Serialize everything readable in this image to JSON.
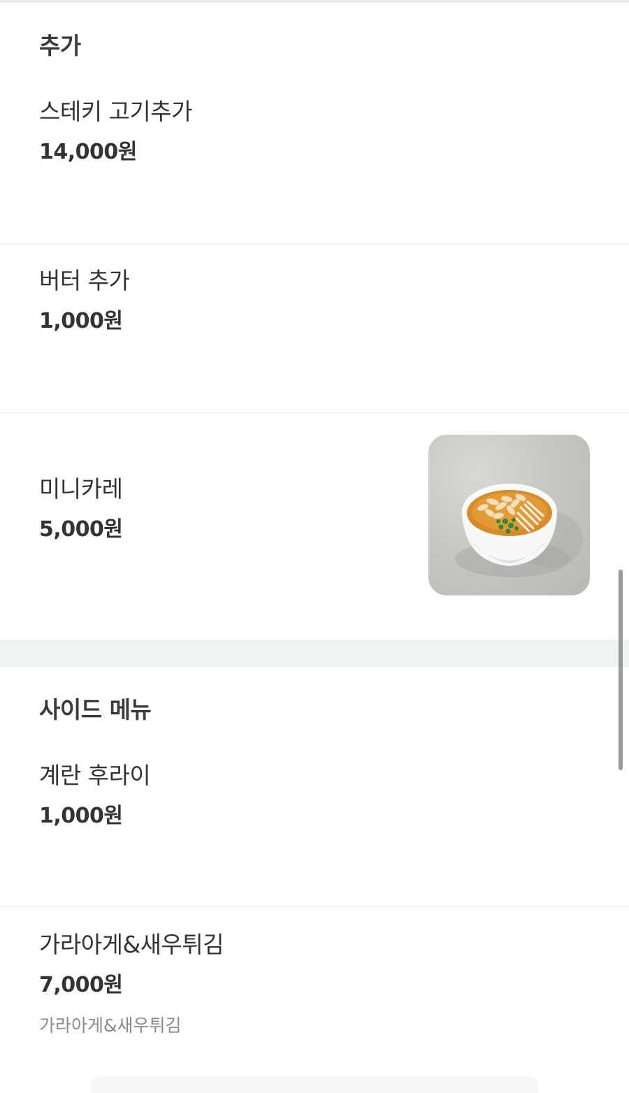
{
  "sections": {
    "add": {
      "title": "추가",
      "items": [
        {
          "name": "스테키 고기추가",
          "price": "14,000원"
        },
        {
          "name": "버터 추가",
          "price": "1,000원"
        },
        {
          "name": "미니카레",
          "price": "5,000원"
        }
      ]
    },
    "side": {
      "title": "사이드 메뉴",
      "items": [
        {
          "name": "계란 후라이",
          "price": "1,000원"
        },
        {
          "name": "가라아게&새우튀김",
          "price": "7,000원",
          "description": "가라아게&새우튀김"
        }
      ]
    }
  }
}
